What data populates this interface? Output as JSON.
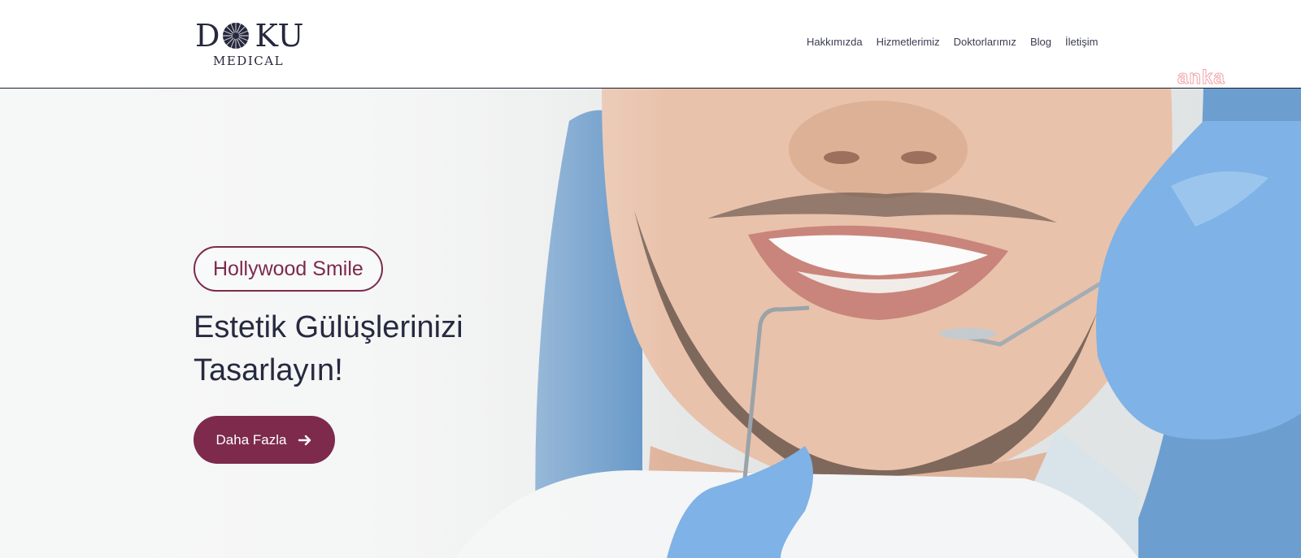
{
  "brand": {
    "name_part1": "D",
    "name_part2": "KU",
    "subtitle": "MEDICAL",
    "logo_icon": "sunburst-o-icon"
  },
  "nav": {
    "items": [
      {
        "label": "Hakkımızda"
      },
      {
        "label": "Hizmetlerimiz"
      },
      {
        "label": "Doktorlarımız"
      },
      {
        "label": "Blog"
      },
      {
        "label": "İletişim"
      }
    ]
  },
  "watermark": "anka",
  "hero": {
    "badge": "Hollywood Smile",
    "headline_line1": "Estetik Gülüşlerinizi",
    "headline_line2": "Tasarlayın!",
    "cta_label": "Daha Fazla",
    "cta_icon": "arrow-right-icon",
    "image": "smiling-man-dental-checkup"
  },
  "colors": {
    "accent": "#7d2a4c",
    "text_dark": "#262a3f",
    "glove_blue": "#7fb2e6",
    "watermark": "#f2a2aa"
  }
}
